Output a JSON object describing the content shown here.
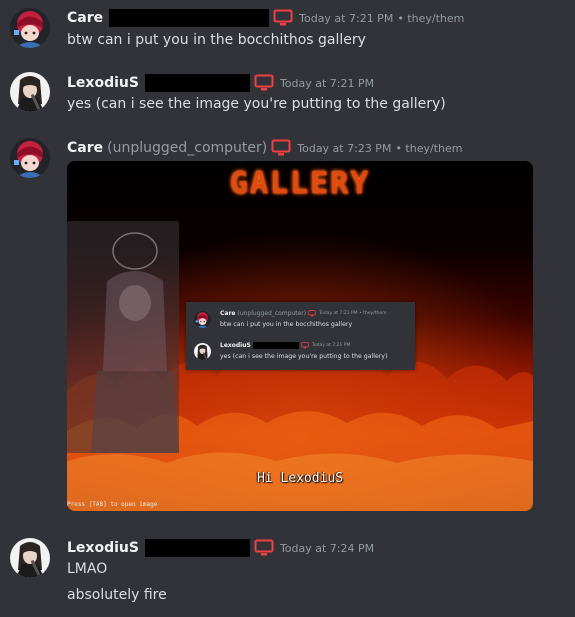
{
  "messages": [
    {
      "username": "Care",
      "handle": "",
      "timestamp": "Today at 7:21 PM",
      "pronouns": "• they/them",
      "lines": [
        "btw can i put you in the bocchithos gallery"
      ]
    },
    {
      "username": "LexodiuS",
      "timestamp": "Today at 7:21 PM",
      "lines": [
        "yes (can i see the image you're putting to the gallery)"
      ]
    },
    {
      "username": "Care",
      "handle": "(unplugged_computer)",
      "timestamp": "Today at 7:23 PM",
      "pronouns": "• they/them",
      "attachment": {
        "title": "GALLERY",
        "greeting": "Hi LexodiuS",
        "hint": "Press [TAB] to open image",
        "quoted": [
          {
            "username": "Care",
            "handle": "(unplugged_computer)",
            "meta": "Today at 7:21 PM • they/them",
            "text": "btw can i put you in the bocchithos gallery"
          },
          {
            "username": "LexodiuS",
            "meta": "Today at 7:21 PM",
            "text": "yes (can i see the image you're putting to the gallery)"
          }
        ]
      }
    },
    {
      "username": "LexodiuS",
      "timestamp": "Today at 7:24 PM",
      "lines": [
        "LMAO",
        "absolutely fire"
      ]
    }
  ],
  "icons": {
    "device": "desktop-monitor-icon",
    "device_color": "#f23f43"
  },
  "colors": {
    "background": "#313338",
    "username": "#f2f3f5",
    "muted": "#949ba4",
    "text": "#dbdee1"
  }
}
